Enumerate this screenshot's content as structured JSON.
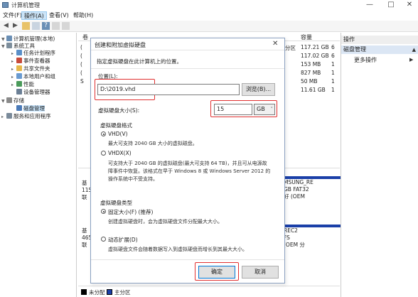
{
  "window": {
    "title": "计算机管理"
  },
  "menu": [
    "文件(F)",
    "操作(A)",
    "查看(V)",
    "帮助(H)"
  ],
  "tree": [
    {
      "label": "计算机管理(本地)",
      "level": 0,
      "icon": "computer-icon",
      "color": "#6a8fb5"
    },
    {
      "label": "系统工具",
      "level": 1,
      "icon": "tools-icon",
      "color": "#7d8e9c"
    },
    {
      "label": "任务计划程序",
      "level": 2,
      "icon": "clock-icon",
      "color": "#5a8fc8"
    },
    {
      "label": "事件查看器",
      "level": 2,
      "icon": "event-icon",
      "color": "#c84a3a"
    },
    {
      "label": "共享文件夹",
      "level": 2,
      "icon": "folder-icon",
      "color": "#e6b84a"
    },
    {
      "label": "本地用户和组",
      "level": 2,
      "icon": "users-icon",
      "color": "#6a9bd1"
    },
    {
      "label": "性能",
      "level": 2,
      "icon": "performance-icon",
      "color": "#4a9a5a"
    },
    {
      "label": "设备管理器",
      "level": 2,
      "icon": "device-icon",
      "color": "#6b7f95"
    },
    {
      "label": "存储",
      "level": 1,
      "icon": "storage-icon",
      "color": "#8a8a8a"
    },
    {
      "label": "磁盘管理",
      "level": 2,
      "icon": "disk-icon",
      "color": "#4a7ab8",
      "selected": true
    },
    {
      "label": "服务和应用程序",
      "level": 1,
      "icon": "services-icon",
      "color": "#7a8a9a"
    }
  ],
  "list": {
    "headers": [
      "卷",
      "容量"
    ],
    "fragments": [
      "分区",
      ""
    ],
    "capacities": [
      "117.21 GB",
      "117.02 GB",
      "153 MB",
      "827 MB",
      "50 MB",
      "11.61 GB"
    ],
    "row_letters": [
      "(",
      "(",
      "(",
      "(",
      "S",
      ""
    ],
    "row_suffix": [
      "6",
      "6",
      "1",
      "1",
      "1",
      "1"
    ]
  },
  "disks": {
    "disk0": [
      "基",
      "115",
      "联"
    ],
    "disk1": [
      "基",
      "465",
      "联"
    ],
    "part0": [
      "MSUNG_RE",
      "GB FAT32",
      "好 (OEM"
    ],
    "part1": [
      "REC2",
      "FS",
      "(OEM 分"
    ]
  },
  "legend": {
    "unallocated": "未分配",
    "primary": "主分区"
  },
  "actions": {
    "header": "操作",
    "section": "磁盘管理",
    "more": "更多操作"
  },
  "dialog": {
    "title": "创建和附加虚拟硬盘",
    "instruction": "指定虚拟硬盘在此计算机上的位置。",
    "location_label": "位置(L):",
    "location_value": "D:\\2019.vhd",
    "browse": "浏览(B)...",
    "size_label": "虚拟硬盘大小(S):",
    "size_value": "15",
    "size_unit": "GB",
    "format_label": "虚拟硬盘格式",
    "vhd_label": "VHD(V)",
    "vhd_desc": "最大可支持 2040 GB 大小的虚拟磁盘。",
    "vhdx_label": "VHDX(X)",
    "vhdx_desc1": "可支持大于 2040 GB 的虚拟磁盘(最大可支持 64 TB)，并且可从电源故",
    "vhdx_desc2": "障事件中恢复。该格式在早于 Windows 8 或 Windows Server 2012 的",
    "vhdx_desc3": "操作系统中不受支持。",
    "type_label": "虚拟硬盘类型",
    "fixed_label": "固定大小(F) (推荐)",
    "fixed_desc": "创建虚拟硬盘时，会为虚拟硬盘文件分配最大大小。",
    "dynamic_label": "动态扩展(D)",
    "dynamic_desc": "虚拟硬盘文件会随着数据写入到虚拟硬盘而增长到其最大大小。",
    "ok": "确定",
    "cancel": "取消",
    "selected_format": "VHD",
    "selected_type": "fixed"
  },
  "colors": {
    "highlight": "#e03030",
    "accent": "#0078d7",
    "partition_bar": "#1a3fa8"
  }
}
